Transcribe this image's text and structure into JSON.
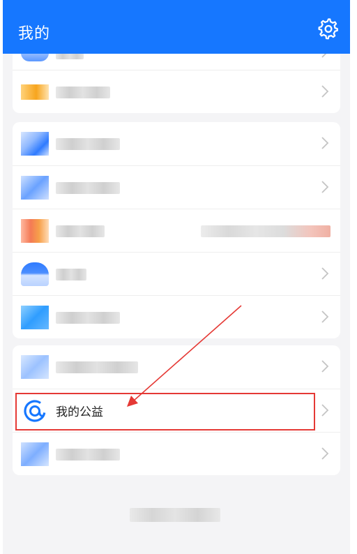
{
  "header": {
    "title": "我的",
    "settings_icon": "gear-icon"
  },
  "colors": {
    "header_bg": "#1677ff",
    "accent": "#1677ff",
    "highlight": "#e53935"
  },
  "cards": {
    "group1": {
      "items": [
        {
          "label": ""
        },
        {
          "label": ""
        }
      ]
    },
    "group2": {
      "items": [
        {
          "label": ""
        },
        {
          "label": ""
        },
        {
          "label": ""
        },
        {
          "label": ""
        },
        {
          "label": ""
        }
      ]
    },
    "group3": {
      "items": [
        {
          "label": ""
        },
        {
          "label": "我的公益",
          "icon": "charity-icon"
        },
        {
          "label": ""
        }
      ]
    }
  }
}
